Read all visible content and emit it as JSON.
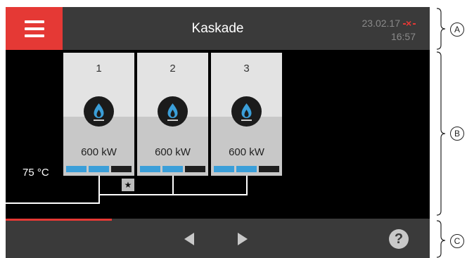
{
  "header": {
    "title": "Kaskade",
    "date": "23.02.17",
    "time": "16:57",
    "menu_icon": "hamburger-icon",
    "connection_icon": "no-connection-icon"
  },
  "cascade": {
    "flow_temperature": "75 °C",
    "lead_boiler_badge": "★",
    "boilers": [
      {
        "number": "1",
        "power": "600 kW",
        "levels": [
          1,
          1,
          0
        ],
        "icon": "gas-flame-icon"
      },
      {
        "number": "2",
        "power": "600 kW",
        "levels": [
          1,
          1,
          0
        ],
        "icon": "gas-flame-icon"
      },
      {
        "number": "3",
        "power": "600 kW",
        "levels": [
          1,
          1,
          0
        ],
        "icon": "gas-flame-icon"
      }
    ]
  },
  "footer": {
    "prev_icon": "triangle-left-icon",
    "next_icon": "triangle-right-icon",
    "help_label": "?",
    "page_progress": 0.25
  },
  "callouts": [
    "A",
    "B",
    "C"
  ],
  "colors": {
    "accent": "#e53935",
    "panel": "#3a3a3a",
    "level_on": "#3b9fd9",
    "level_off": "#1e1e1e",
    "flame": "#3b9fd9"
  }
}
